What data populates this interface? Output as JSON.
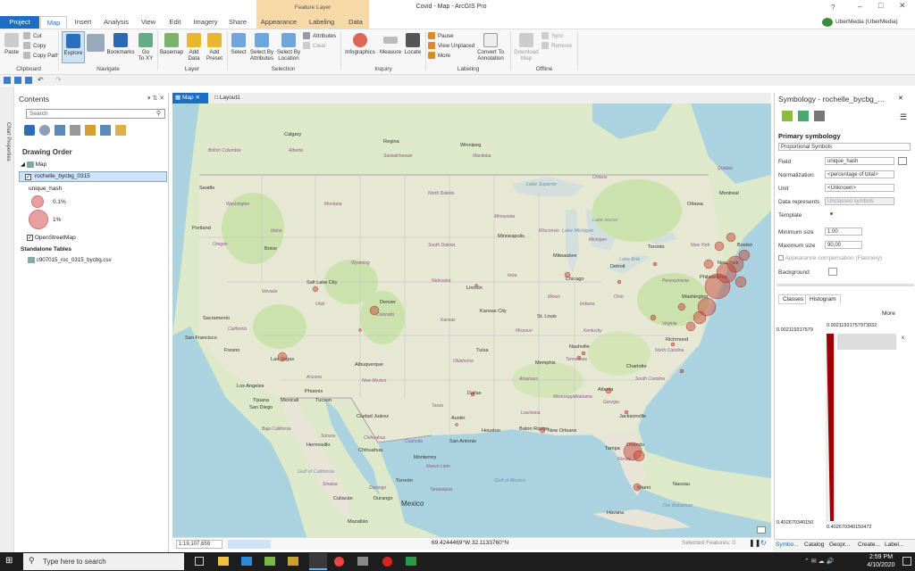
{
  "titlebar": {
    "title": "Covid - Map - ArcGIS Pro",
    "context_group": "Feature Layer",
    "user": "UberMedia (UberMedia)",
    "help": "?"
  },
  "tabs": {
    "project": "Project",
    "map": "Map",
    "insert": "Insert",
    "analysis": "Analysis",
    "view": "View",
    "edit": "Edit",
    "imagery": "Imagery",
    "share": "Share",
    "appearance": "Appearance",
    "labeling": "Labeling",
    "data": "Data"
  },
  "ribbon": {
    "clipboard": {
      "label": "Clipboard",
      "paste": "Paste",
      "cut": "Cut",
      "copy": "Copy",
      "copy_path": "Copy Path"
    },
    "navigate": {
      "label": "Navigate",
      "explore": "Explore",
      "bookmarks": "Bookmarks",
      "go_to_xy": "Go\nTo XY"
    },
    "layer": {
      "label": "Layer",
      "basemap": "Basemap",
      "add_data": "Add\nData",
      "add_preset": "Add\nPreset"
    },
    "selection": {
      "label": "Selection",
      "select": "Select",
      "select_by_attributes": "Select By\nAttributes",
      "select_by_location": "Select By\nLocation",
      "attributes": "Attributes",
      "clear": "Clear"
    },
    "inquiry": {
      "label": "Inquiry",
      "infographics": "Infographics",
      "measure": "Measure",
      "locate": "Locate"
    },
    "labeling": {
      "label": "Labeling",
      "pause": "Pause",
      "view_unplaced": "View Unplaced",
      "more": "More",
      "convert": "Convert To\nAnnotation"
    },
    "offline": {
      "label": "Offline",
      "download_map": "Download\nMap",
      "sync": "Sync",
      "remove": "Remove"
    }
  },
  "leftstrip": {
    "text": "Chart Properties"
  },
  "contents": {
    "title": "Contents",
    "search_placeholder": "Search",
    "drawing_order": "Drawing Order",
    "map": "Map",
    "layer": "rochelle_bycbg_0315",
    "field": "unique_hash",
    "legend_small": "0.1%",
    "legend_large": "1%",
    "basemap": "OpenStreetMap",
    "standalone_tables": "Standalone Tables",
    "table": "c907015_roc_0315_bycbg.csv"
  },
  "maptabs": {
    "map": "Map",
    "layout": "Layout1"
  },
  "mapstatus": {
    "scale": "1:19,107,659",
    "coords": "69.4244469°W 32.1133760°N",
    "selected": "Selected Features: 0"
  },
  "map": {
    "cities": [
      "Calgary",
      "Regina",
      "Winnipeg",
      "Seattle",
      "Portland",
      "Boise",
      "Salt Lake City",
      "Denver",
      "Sacramento",
      "San Francisco",
      "Fresno",
      "Las Vegas",
      "Los Angeles",
      "San Diego",
      "Tijuana",
      "Mexicali",
      "Phoenix",
      "Tucson",
      "Albuquerque",
      "Ciudad Juárez",
      "Minneapolis",
      "Milwaukee",
      "Chicago",
      "Detroit",
      "Toronto",
      "Montreal",
      "Ottawa",
      "Boston",
      "New York",
      "Philadelphia",
      "Washington",
      "Lincoln",
      "Kansas City",
      "St. Louis",
      "Nashville",
      "Memphis",
      "Tulsa",
      "Dallas",
      "Austin",
      "San Antonio",
      "Houston",
      "New Orleans",
      "Baton Rouge",
      "Atlanta",
      "Charlotte",
      "Richmond",
      "Jacksonville",
      "Orlando",
      "Tampa",
      "Miami",
      "Havana",
      "Nassau",
      "Monterrey",
      "Chihuahua",
      "Hermosillo",
      "Torreón",
      "Durango",
      "Culiacán",
      "Mazatlán",
      "Mexico"
    ],
    "states": [
      "Washington",
      "Oregon",
      "Idaho",
      "Montana",
      "Wyoming",
      "Nevada",
      "Utah",
      "Colorado",
      "Arizona",
      "New Mexico",
      "California",
      "North Dakota",
      "South Dakota",
      "Nebraska",
      "Kansas",
      "Oklahoma",
      "Texas",
      "Minnesota",
      "Iowa",
      "Missouri",
      "Arkansas",
      "Louisiana",
      "Mississippi",
      "Alabama",
      "Georgia",
      "Florida",
      "Tennessee",
      "Kentucky",
      "Illinois",
      "Indiana",
      "Ohio",
      "Michigan",
      "Wisconsin",
      "Pennsylvania",
      "New York",
      "Virginia",
      "North Carolina",
      "South Carolina",
      "Ontario",
      "Quebec",
      "Manitoba",
      "Saskatchewan",
      "Alberta",
      "British Columbia",
      "Baja California",
      "Sonora",
      "Chihuahua",
      "Coahuila",
      "Nuevo León",
      "Sinaloa",
      "Durango",
      "Tamaulipas"
    ],
    "water": [
      "Lake Superior",
      "Lake Michigan",
      "Lake Huron",
      "Lake Erie",
      "Gulf of Mexico",
      "The Bahamas",
      "Gulf of California"
    ],
    "symbol_color": "#c0392b"
  },
  "symbology": {
    "title": "Symbology - rochelle_bycbg_...",
    "pin": "⌂",
    "close": "✕",
    "primary": "Primary symbology",
    "method": "Proportional Symbols",
    "field_label": "Field",
    "field_value": "unique_hash",
    "normalization_label": "Normalization",
    "normalization_value": "<percentage of total>",
    "unit_label": "Unit",
    "unit_value": "<Unknown>",
    "data_represents_label": "Data represents",
    "data_represents_value": "Unclassed symbols",
    "template_label": "Template",
    "min_label": "Minimum size",
    "min_value": "1.00",
    "max_label": "Maximum size",
    "max_value": "90.00",
    "appearance_comp": "Appearance compensation (Flannery)",
    "background": "Background",
    "tab_classes": "Classes",
    "tab_histogram": "Histogram",
    "more": "More",
    "hist_top": "0.00211931757973932",
    "hist_top_left": "0.002119317579",
    "hist_bottom": "0.402670340150472",
    "hist_bottom_left": "0.402670340150"
  },
  "bottomtabs": [
    "Symbo...",
    "Catalog",
    "Geopr...",
    "Create...",
    "Label..."
  ],
  "taskbar": {
    "search": "Type here to search",
    "time": "2:59 PM",
    "date": "4/10/2020"
  }
}
